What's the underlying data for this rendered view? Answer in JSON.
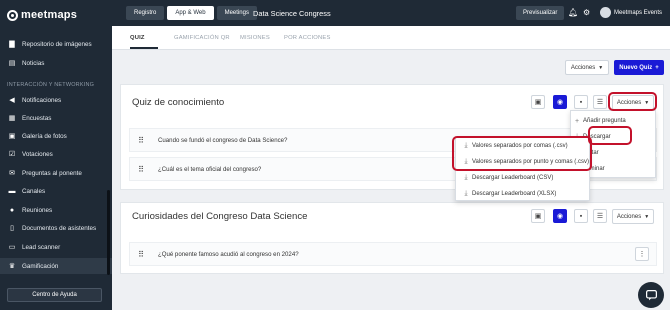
{
  "brand": {
    "logo_text": "meetmaps"
  },
  "sidebar": {
    "items_top": [
      {
        "label": "Repositorio de imágenes",
        "icon": "folder-icon"
      },
      {
        "label": "Noticias",
        "icon": "news-icon"
      }
    ],
    "section_label": "INTERACCIÓN Y NETWORKING",
    "items": [
      {
        "label": "Notificaciones",
        "icon": "megaphone-icon"
      },
      {
        "label": "Encuestas",
        "icon": "poll-icon"
      },
      {
        "label": "Galería de fotos",
        "icon": "image-icon"
      },
      {
        "label": "Votaciones",
        "icon": "vote-icon"
      },
      {
        "label": "Preguntas al ponente",
        "icon": "chat-icon"
      },
      {
        "label": "Canales",
        "icon": "channels-icon"
      },
      {
        "label": "Reuniones",
        "icon": "meeting-icon"
      },
      {
        "label": "Documentos de asistentes",
        "icon": "document-icon"
      },
      {
        "label": "Lead scanner",
        "icon": "scanner-icon"
      },
      {
        "label": "Gamificación",
        "icon": "trophy-icon"
      }
    ],
    "active_item": "Gamificación",
    "help_button": "Centro de Ayuda"
  },
  "topbar": {
    "tabs": [
      "Registro",
      "App & Web",
      "Meetings"
    ],
    "active_tab": "App & Web",
    "event_name": "Data Science Congress",
    "preview_button": "Previsualizar",
    "user_name": "Meetmaps Events"
  },
  "subtabs": {
    "items": [
      "QUIZ",
      "GAMIFICACIÓN QR",
      "MISIONES",
      "POR ACCIONES"
    ],
    "active": "QUIZ"
  },
  "page_actions": {
    "actions_label": "Acciones",
    "new_quiz_label": "Nuevo Quiz",
    "plus": "+"
  },
  "quiz1": {
    "title": "Quiz de conocimiento",
    "actions_label": "Acciones",
    "questions": [
      "Cuando se fundó el congreso de Data Science?",
      "¿Cuál es el tema oficial del congreso?"
    ],
    "actions_menu": [
      "Añadir pregunta",
      "Descargar",
      "Editar",
      "Eliminar"
    ],
    "download_submenu": [
      "Valores separados por comas (.csv)",
      "Valores separados por punto y comas (.csv)",
      "Descargar Leaderboard (CSV)",
      "Descargar Leaderboard (XLSX)"
    ]
  },
  "quiz2": {
    "title": "Curiosidades del Congreso Data Science",
    "actions_label": "Acciones",
    "questions": [
      "¿Qué ponente famoso acudió al congreso en 2024?"
    ]
  },
  "colors": {
    "sidebar_bg": "#1f2a36",
    "primary": "#1a1ad6",
    "highlight": "#c3112b"
  }
}
